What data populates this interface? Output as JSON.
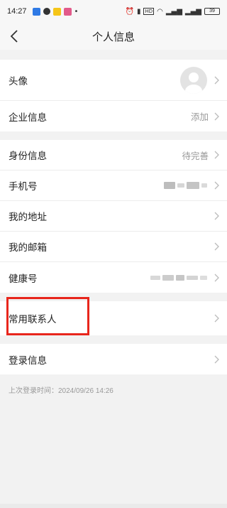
{
  "status_bar": {
    "time": "14:27",
    "battery": "39"
  },
  "nav": {
    "title": "个人信息"
  },
  "group1": [
    {
      "label": "头像",
      "value": ""
    },
    {
      "label": "企业信息",
      "value": "添加"
    }
  ],
  "group2": [
    {
      "label": "身份信息",
      "value": "待完善"
    },
    {
      "label": "手机号",
      "value": ""
    },
    {
      "label": "我的地址",
      "value": ""
    },
    {
      "label": "我的邮箱",
      "value": ""
    },
    {
      "label": "健康号",
      "value": ""
    }
  ],
  "group3": [
    {
      "label": "常用联系人"
    }
  ],
  "group4": [
    {
      "label": "登录信息"
    }
  ],
  "login_time": "上次登录时间：2024/09/26  14:26",
  "colors": {
    "highlight": "#e8261c",
    "background": "#f2f2f2"
  }
}
